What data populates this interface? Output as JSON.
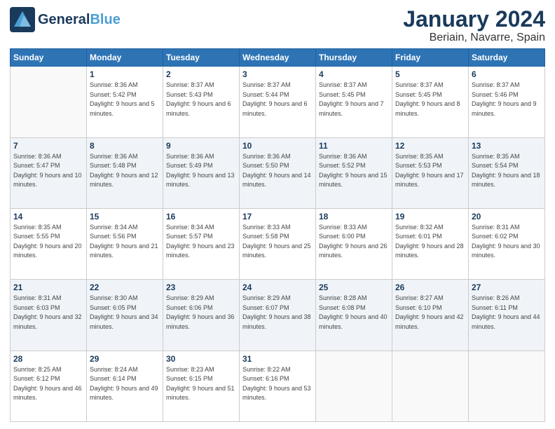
{
  "header": {
    "logo_line1": "General",
    "logo_line2": "Blue",
    "month": "January 2024",
    "location": "Beriain, Navarre, Spain"
  },
  "weekdays": [
    "Sunday",
    "Monday",
    "Tuesday",
    "Wednesday",
    "Thursday",
    "Friday",
    "Saturday"
  ],
  "weeks": [
    [
      {
        "day": "",
        "sunrise": "",
        "sunset": "",
        "daylight": ""
      },
      {
        "day": "1",
        "sunrise": "Sunrise: 8:36 AM",
        "sunset": "Sunset: 5:42 PM",
        "daylight": "Daylight: 9 hours and 5 minutes."
      },
      {
        "day": "2",
        "sunrise": "Sunrise: 8:37 AM",
        "sunset": "Sunset: 5:43 PM",
        "daylight": "Daylight: 9 hours and 6 minutes."
      },
      {
        "day": "3",
        "sunrise": "Sunrise: 8:37 AM",
        "sunset": "Sunset: 5:44 PM",
        "daylight": "Daylight: 9 hours and 6 minutes."
      },
      {
        "day": "4",
        "sunrise": "Sunrise: 8:37 AM",
        "sunset": "Sunset: 5:45 PM",
        "daylight": "Daylight: 9 hours and 7 minutes."
      },
      {
        "day": "5",
        "sunrise": "Sunrise: 8:37 AM",
        "sunset": "Sunset: 5:45 PM",
        "daylight": "Daylight: 9 hours and 8 minutes."
      },
      {
        "day": "6",
        "sunrise": "Sunrise: 8:37 AM",
        "sunset": "Sunset: 5:46 PM",
        "daylight": "Daylight: 9 hours and 9 minutes."
      }
    ],
    [
      {
        "day": "7",
        "sunrise": "Sunrise: 8:36 AM",
        "sunset": "Sunset: 5:47 PM",
        "daylight": "Daylight: 9 hours and 10 minutes."
      },
      {
        "day": "8",
        "sunrise": "Sunrise: 8:36 AM",
        "sunset": "Sunset: 5:48 PM",
        "daylight": "Daylight: 9 hours and 12 minutes."
      },
      {
        "day": "9",
        "sunrise": "Sunrise: 8:36 AM",
        "sunset": "Sunset: 5:49 PM",
        "daylight": "Daylight: 9 hours and 13 minutes."
      },
      {
        "day": "10",
        "sunrise": "Sunrise: 8:36 AM",
        "sunset": "Sunset: 5:50 PM",
        "daylight": "Daylight: 9 hours and 14 minutes."
      },
      {
        "day": "11",
        "sunrise": "Sunrise: 8:36 AM",
        "sunset": "Sunset: 5:52 PM",
        "daylight": "Daylight: 9 hours and 15 minutes."
      },
      {
        "day": "12",
        "sunrise": "Sunrise: 8:35 AM",
        "sunset": "Sunset: 5:53 PM",
        "daylight": "Daylight: 9 hours and 17 minutes."
      },
      {
        "day": "13",
        "sunrise": "Sunrise: 8:35 AM",
        "sunset": "Sunset: 5:54 PM",
        "daylight": "Daylight: 9 hours and 18 minutes."
      }
    ],
    [
      {
        "day": "14",
        "sunrise": "Sunrise: 8:35 AM",
        "sunset": "Sunset: 5:55 PM",
        "daylight": "Daylight: 9 hours and 20 minutes."
      },
      {
        "day": "15",
        "sunrise": "Sunrise: 8:34 AM",
        "sunset": "Sunset: 5:56 PM",
        "daylight": "Daylight: 9 hours and 21 minutes."
      },
      {
        "day": "16",
        "sunrise": "Sunrise: 8:34 AM",
        "sunset": "Sunset: 5:57 PM",
        "daylight": "Daylight: 9 hours and 23 minutes."
      },
      {
        "day": "17",
        "sunrise": "Sunrise: 8:33 AM",
        "sunset": "Sunset: 5:58 PM",
        "daylight": "Daylight: 9 hours and 25 minutes."
      },
      {
        "day": "18",
        "sunrise": "Sunrise: 8:33 AM",
        "sunset": "Sunset: 6:00 PM",
        "daylight": "Daylight: 9 hours and 26 minutes."
      },
      {
        "day": "19",
        "sunrise": "Sunrise: 8:32 AM",
        "sunset": "Sunset: 6:01 PM",
        "daylight": "Daylight: 9 hours and 28 minutes."
      },
      {
        "day": "20",
        "sunrise": "Sunrise: 8:31 AM",
        "sunset": "Sunset: 6:02 PM",
        "daylight": "Daylight: 9 hours and 30 minutes."
      }
    ],
    [
      {
        "day": "21",
        "sunrise": "Sunrise: 8:31 AM",
        "sunset": "Sunset: 6:03 PM",
        "daylight": "Daylight: 9 hours and 32 minutes."
      },
      {
        "day": "22",
        "sunrise": "Sunrise: 8:30 AM",
        "sunset": "Sunset: 6:05 PM",
        "daylight": "Daylight: 9 hours and 34 minutes."
      },
      {
        "day": "23",
        "sunrise": "Sunrise: 8:29 AM",
        "sunset": "Sunset: 6:06 PM",
        "daylight": "Daylight: 9 hours and 36 minutes."
      },
      {
        "day": "24",
        "sunrise": "Sunrise: 8:29 AM",
        "sunset": "Sunset: 6:07 PM",
        "daylight": "Daylight: 9 hours and 38 minutes."
      },
      {
        "day": "25",
        "sunrise": "Sunrise: 8:28 AM",
        "sunset": "Sunset: 6:08 PM",
        "daylight": "Daylight: 9 hours and 40 minutes."
      },
      {
        "day": "26",
        "sunrise": "Sunrise: 8:27 AM",
        "sunset": "Sunset: 6:10 PM",
        "daylight": "Daylight: 9 hours and 42 minutes."
      },
      {
        "day": "27",
        "sunrise": "Sunrise: 8:26 AM",
        "sunset": "Sunset: 6:11 PM",
        "daylight": "Daylight: 9 hours and 44 minutes."
      }
    ],
    [
      {
        "day": "28",
        "sunrise": "Sunrise: 8:25 AM",
        "sunset": "Sunset: 6:12 PM",
        "daylight": "Daylight: 9 hours and 46 minutes."
      },
      {
        "day": "29",
        "sunrise": "Sunrise: 8:24 AM",
        "sunset": "Sunset: 6:14 PM",
        "daylight": "Daylight: 9 hours and 49 minutes."
      },
      {
        "day": "30",
        "sunrise": "Sunrise: 8:23 AM",
        "sunset": "Sunset: 6:15 PM",
        "daylight": "Daylight: 9 hours and 51 minutes."
      },
      {
        "day": "31",
        "sunrise": "Sunrise: 8:22 AM",
        "sunset": "Sunset: 6:16 PM",
        "daylight": "Daylight: 9 hours and 53 minutes."
      },
      {
        "day": "",
        "sunrise": "",
        "sunset": "",
        "daylight": ""
      },
      {
        "day": "",
        "sunrise": "",
        "sunset": "",
        "daylight": ""
      },
      {
        "day": "",
        "sunrise": "",
        "sunset": "",
        "daylight": ""
      }
    ]
  ]
}
